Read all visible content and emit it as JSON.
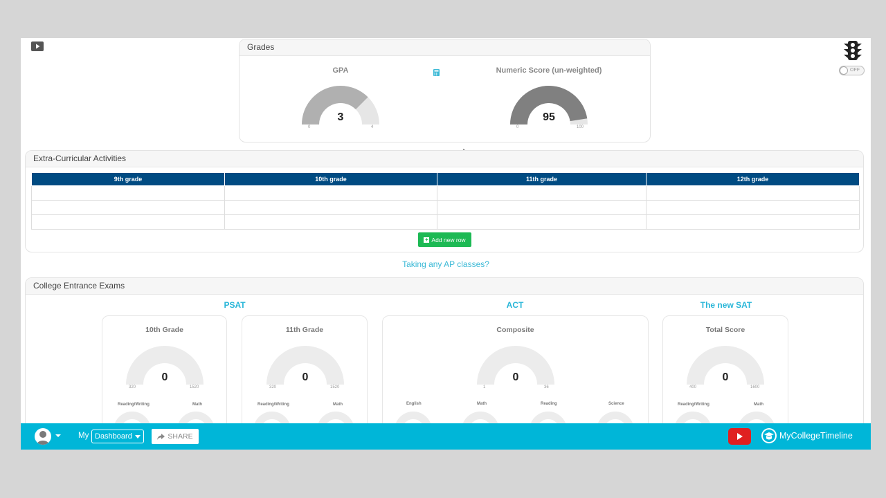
{
  "grades": {
    "title": "Grades",
    "gpa": {
      "title": "GPA",
      "value": "3",
      "min": "0",
      "max": "4",
      "fraction": 0.75,
      "color": "#b0b0b0"
    },
    "numeric": {
      "title": "Numeric Score (un-weighted)",
      "value": "95",
      "min": "0",
      "max": "100",
      "fraction": 0.95,
      "color": "#808080"
    }
  },
  "toggle": {
    "label": "OFF"
  },
  "eca": {
    "title": "Extra-Curricular Activities",
    "columns": [
      "9th grade",
      "10th grade",
      "11th grade",
      "12th grade"
    ],
    "add_row_label": "Add new row"
  },
  "ap_link": "Taking any AP classes?",
  "exams": {
    "title": "College Entrance Exams",
    "psat": {
      "heading": "PSAT",
      "cards": [
        {
          "title": "10th Grade",
          "value": "0",
          "min": "320",
          "max": "1520",
          "subs": [
            "Reading/Writing",
            "Math"
          ]
        },
        {
          "title": "11th Grade",
          "value": "0",
          "min": "320",
          "max": "1520",
          "subs": [
            "Reading/Writing",
            "Math"
          ]
        }
      ]
    },
    "act": {
      "heading": "ACT",
      "card": {
        "title": "Composite",
        "value": "0",
        "min": "1",
        "max": "36",
        "subs": [
          "English",
          "Math",
          "Reading",
          "Science"
        ]
      }
    },
    "sat": {
      "heading": "The new SAT",
      "card": {
        "title": "Total Score",
        "value": "0",
        "min": "400",
        "max": "1600",
        "subs": [
          "Reading/Writing",
          "Math"
        ]
      }
    }
  },
  "footer": {
    "my_label": "My",
    "dashboard_label": "Dashboard",
    "share_label": "SHARE",
    "brand": "MyCollegeTimeline"
  },
  "colors": {
    "accent": "#00b6d8",
    "table_header": "#004b82",
    "add_button": "#1db954",
    "link": "#3bb9d6"
  }
}
